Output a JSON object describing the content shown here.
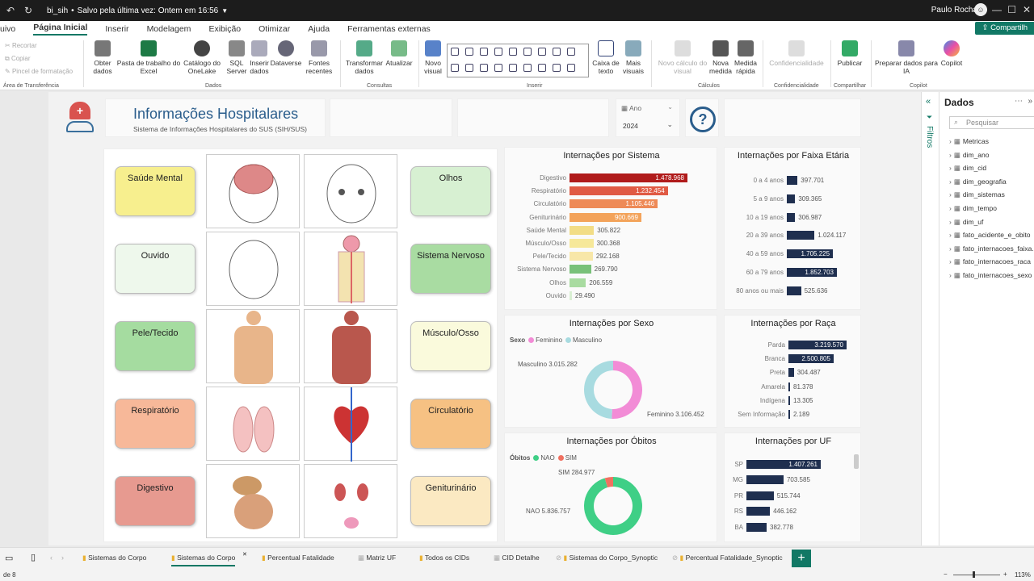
{
  "titlebar": {
    "doc_name": "bi_sih",
    "save_status": "Salvo pela última vez: Ontem em 16:56",
    "user": "Paulo Rocha"
  },
  "menu": [
    "uivo",
    "Página Inicial",
    "Inserir",
    "Modelagem",
    "Exibição",
    "Otimizar",
    "Ajuda",
    "Ferramentas externas"
  ],
  "share_label": "Compartilh",
  "ribbon": {
    "clipboard": [
      "Recortar",
      "Copiar",
      "Pincel de formatação"
    ],
    "clipboard_group": "Área de Transferência",
    "data": [
      "Obter dados",
      "Pasta de trabalho do Excel",
      "Catálogo do OneLake",
      "SQL Server",
      "Inserir dados",
      "Dataverse",
      "Fontes recentes"
    ],
    "data_group": "Dados",
    "queries": [
      "Transformar dados",
      "Atualizar"
    ],
    "queries_group": "Consultas",
    "insert": [
      "Novo visual",
      "Caixa de texto",
      "Mais visuais"
    ],
    "insert_group": "Inserir",
    "calc": [
      "Novo cálculo do visual",
      "Nova medida",
      "Medida rápida"
    ],
    "calc_group": "Cálculos",
    "sens": "Confidencialidade",
    "sens_group": "Confidencialidade",
    "publish": "Publicar",
    "publish_group": "Compartilhar",
    "copilot": [
      "Preparar dados para IA",
      "Copilot"
    ],
    "copilot_group": "Copilot"
  },
  "header": {
    "title": "Informações Hospitalares",
    "subtitle": "Sistema de Informações Hospitalares do SUS (SIH/SUS)",
    "filter_label": "Ano",
    "filter_value": "2024",
    "help": "?"
  },
  "body_labels": {
    "l1": "Saúde Mental",
    "l2": "Ouvido",
    "l3": "Pele/Tecido",
    "l4": "Respiratório",
    "l5": "Digestivo",
    "r1": "Olhos",
    "r2": "Sistema Nervoso",
    "r3": "Músculo/Osso",
    "r4": "Circulatório",
    "r5": "Geniturinário"
  },
  "titles": {
    "sistema": "Internações por Sistema",
    "faixa": "Internações por Faixa Etária",
    "sexo": "Internações por Sexo",
    "raca": "Internações por Raça",
    "obitos": "Internações por Óbitos",
    "uf": "Internações por UF"
  },
  "legend": {
    "sexo_title": "Sexo",
    "sexo_f": "Feminino",
    "sexo_m": "Masculino",
    "ob_title": "Óbitos",
    "ob_nao": "NAO",
    "ob_sim": "SIM"
  },
  "donut_labels": {
    "masc": "Masculino 3.015.282",
    "fem": "Feminino 3.106.452",
    "sim": "SIM 284.977",
    "nao": "NAO 5.836.757"
  },
  "pane": {
    "title": "Dados",
    "search": "Pesquisar",
    "filters": "Filtros",
    "fields": [
      "Metricas",
      "dim_ano",
      "dim_cid",
      "dim_geografia",
      "dim_sistemas",
      "dim_tempo",
      "dim_uf",
      "fato_acidente_e_obito",
      "fato_internacoes_faixa...",
      "fato_internacoes_raca",
      "fato_internacoes_sexo"
    ]
  },
  "tabs": [
    "Sistemas do Corpo",
    "Sistemas do Corpo",
    "Percentual Fatalidade",
    "Matriz UF",
    "Todos os CIDs",
    "CID Detalhe",
    "Sistemas do Corpo_Synoptic",
    "Percentual Fatalidade_Synoptic"
  ],
  "status": {
    "page": "de 8",
    "zoom": "113%"
  },
  "chart_data": [
    {
      "type": "bar",
      "title": "Internações por Sistema",
      "categories": [
        "Digestivo",
        "Respiratório",
        "Circulatório",
        "Geniturinário",
        "Saúde Mental",
        "Músculo/Osso",
        "Pele/Tecido",
        "Sistema Nervoso",
        "Olhos",
        "Ouvido"
      ],
      "values": [
        1478968,
        1232454,
        1105446,
        900669,
        305822,
        300368,
        292168,
        269790,
        206559,
        29490
      ],
      "labels": [
        "1.478.968",
        "1.232.454",
        "1.105.446",
        "900.669",
        "305.822",
        "300.368",
        "292.168",
        "269.790",
        "206.559",
        "29.490"
      ],
      "colors": [
        "#b01b1b",
        "#e05a44",
        "#ee8a57",
        "#f3a35a",
        "#f2dd86",
        "#f6e89a",
        "#f8e7a8",
        "#79c179",
        "#a8dba0",
        "#d9efd3"
      ]
    },
    {
      "type": "bar",
      "title": "Internações por Faixa Etária",
      "categories": [
        "0 a 4 anos",
        "5 a 9 anos",
        "10 a 19 anos",
        "20 a 39 anos",
        "40 a 59 anos",
        "60 a 79 anos",
        "80 anos ou mais"
      ],
      "values": [
        397701,
        309365,
        306987,
        1024117,
        1705225,
        1852703,
        525636
      ],
      "labels": [
        "397.701",
        "309.365",
        "306.987",
        "1.024.117",
        "1.705.225",
        "1.852.703",
        "525.636"
      ]
    },
    {
      "type": "bar",
      "title": "Internações por Raça",
      "categories": [
        "Parda",
        "Branca",
        "Preta",
        "Amarela",
        "Indígena",
        "Sem Informação"
      ],
      "values": [
        3219570,
        2500805,
        304487,
        81378,
        13305,
        2189
      ],
      "labels": [
        "3.219.570",
        "2.500.805",
        "304.487",
        "81.378",
        "13.305",
        "2.189"
      ]
    },
    {
      "type": "bar",
      "title": "Internações por UF",
      "categories": [
        "SP",
        "MG",
        "PR",
        "RS",
        "BA"
      ],
      "values": [
        1407261,
        703585,
        515744,
        446162,
        382778
      ],
      "labels": [
        "1.407.261",
        "703.585",
        "515.744",
        "446.162",
        "382.778"
      ]
    },
    {
      "type": "pie",
      "title": "Internações por Sexo",
      "categories": [
        "Feminino",
        "Masculino"
      ],
      "values": [
        3106452,
        3015282
      ],
      "colors": [
        "#f28cd6",
        "#a8dbe0"
      ]
    },
    {
      "type": "pie",
      "title": "Internações por Óbitos",
      "categories": [
        "NAO",
        "SIM"
      ],
      "values": [
        5836757,
        284977
      ],
      "colors": [
        "#3fcf86",
        "#f07060"
      ]
    }
  ]
}
